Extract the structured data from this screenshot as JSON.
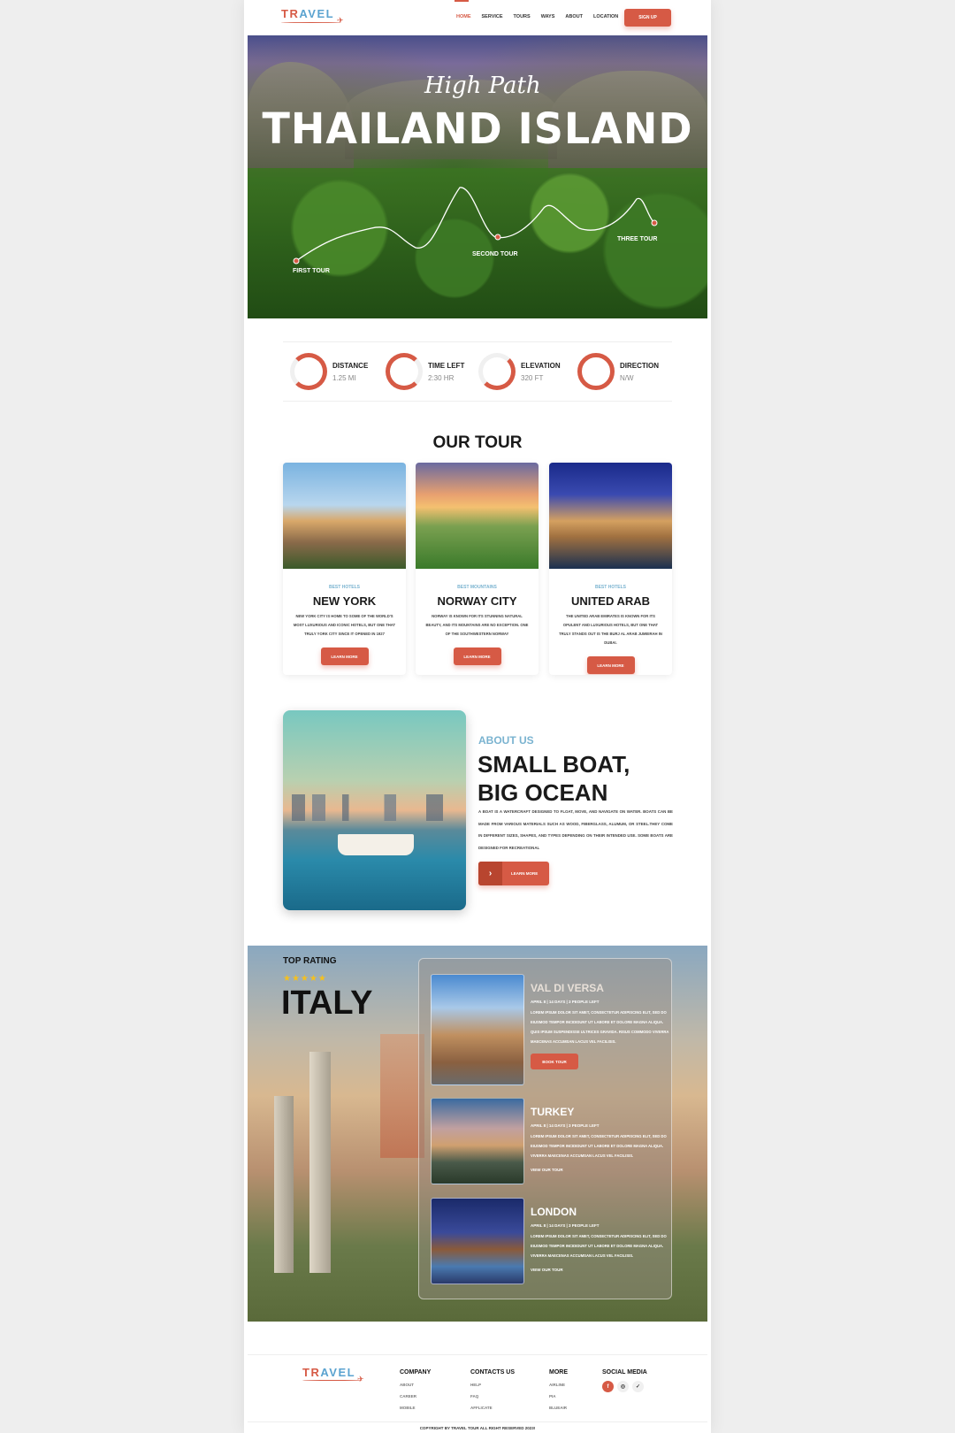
{
  "nav": {
    "logo_part1": "TR",
    "logo_part2": "AVEL",
    "items": [
      "HOME",
      "SERVICE",
      "TOURS",
      "WAYS",
      "ABOUT",
      "LOCATION"
    ],
    "signup": "SIGN UP"
  },
  "hero": {
    "script_title": "High Path",
    "title": "THAILAND ISLAND",
    "tours": [
      "FIRST TOUR",
      "SECOND TOUR",
      "THREE TOUR"
    ]
  },
  "stats": [
    {
      "title": "DISTANCE",
      "value": "1.25 MI"
    },
    {
      "title": "TIME LEFT",
      "value": "2:30 HR"
    },
    {
      "title": "ELEVATION",
      "value": "320 FT"
    },
    {
      "title": "DIRECTION",
      "value": "N/W"
    }
  ],
  "our_tour": {
    "title": "OUR TOUR",
    "cards": [
      {
        "category": "BEST HOTELS",
        "title": "NEW YORK",
        "desc": "NEW YORK CITY IS HOME TO SOME OF THE WORLD'S MOST LUXURIOUS AND ICONIC HOTELS, BUT ONE THAT TRULY YORK CITY SINCE IT OPENED IN 1927",
        "button": "LEARN MORE"
      },
      {
        "category": "BEST MOUNTAINS",
        "title": "NORWAY CITY",
        "desc": "NORWAY IS KNOWN FOR ITS STUNNING NATURAL BEAUTY, AND ITS MOUNTAINS ARE NO EXCEPTION. ONE OF THE SOUTHWESTERN NORWAY",
        "button": "LEARN MORE"
      },
      {
        "category": "BEST HOTELS",
        "title": "UNITED ARAB",
        "desc": "THE UNITED ARAB EMIRATES IS KNOWN FOR ITS OPULENT AND LUXURIOUS HOTELS, BUT ONE THAT TRULY STANDS OUT IS THE BURJ AL ARAB JUMEIRAH IN DUBAI.",
        "button": "LEARN MORE"
      }
    ]
  },
  "about": {
    "label": "ABOUT US",
    "title_line1": "SMALL BOAT,",
    "title_line2": "BIG OCEAN",
    "text": "A BOAT IS A WATERCRAFT DESIGNED TO FLOAT, MOVE, AND NAVIGATE ON WATER. BOATS CAN BE MADE FROM VARIOUS MATERIALS SUCH AS WOOD, FIBERGLASS, ALUMUM, OR STEEL.THEY COME IN DIFFERENT SIZES, SHAPES, AND TYPES DEPENDING ON THEIR INTENDED USE. SOME BOATS ARE DESIGNED FOR RECREATIONAL",
    "button": "LEARN MORE",
    "chevron": "›"
  },
  "italy": {
    "top_label": "TOP RATING",
    "stars": "★★★★★",
    "title": "ITALY",
    "destinations": [
      {
        "name": "VAL DI VERSA",
        "meta": "APRIL 8 | 14 DAYS | 3 PEOPLE LEFT",
        "desc": "LOREM IPSUM DOLOR SIT AMET, CONSECTETUR ADIPISCING ELIT, SED DO EIUSMOD TEMPOR INCIDIDUNT UT LABORE ET DOLORE MAGNA ALIQUA. QUIS IPSUM SUSPENDISSE ULTRICES GRAVIDA. RISUS COMMODO VIVERRA MAECENAS ACCUMSAN LACUS VEL FACILISIS.",
        "action": "BOOK TOUR"
      },
      {
        "name": "TURKEY",
        "meta": "APRIL 8 | 14 DAYS | 3 PEOPLE LEFT",
        "desc": "LOREM IPSUM DOLOR SIT AMET, CONSECTETUR ADIPISCING ELIT, SED DO EIUSMOD TEMPOR INCIDIDUNT UT LABORE ET DOLORE MAGNA ALIQUA. VIVERRA MAECENAS ACCUMSAN LACUS VEL FACILISIS.",
        "action": "VIEW OUR TOUR"
      },
      {
        "name": "LONDON",
        "meta": "APRIL 8 | 14 DAYS | 3 PEOPLE LEFT",
        "desc": "LOREM IPSUM DOLOR SIT AMET, CONSECTETUR ADIPISCING ELIT, SED DO EIUSMOD TEMPOR INCIDIDUNT UT LABORE ET DOLORE MAGNA ALIQUA. VIVERRA MAECENAS ACCUMSAN LACUS VEL FACILISIS.",
        "action": "VIEW OUR TOUR"
      }
    ]
  },
  "footer": {
    "logo_part1": "TR",
    "logo_part2": "AVEL",
    "columns": [
      {
        "title": "COMPANY",
        "items": [
          "ABOUT",
          "CAREER",
          "MOBILE"
        ]
      },
      {
        "title": "CONTACTS US",
        "items": [
          "HELP",
          "FAQ",
          "AFFLICATE"
        ]
      },
      {
        "title": "MORE",
        "items": [
          "AIRLINE",
          "PIA",
          "BLUEAIR"
        ]
      }
    ],
    "social_title": "SOCIAL MEDIA",
    "social_icons": [
      "f",
      "◎",
      "✓"
    ],
    "copyright": "COPYRIGHT BY TRAVEL TOUR ALL RIGHT RESERVED 2023!"
  },
  "colors": {
    "accent": "#d65a45",
    "secondary": "#7ab3d0"
  }
}
